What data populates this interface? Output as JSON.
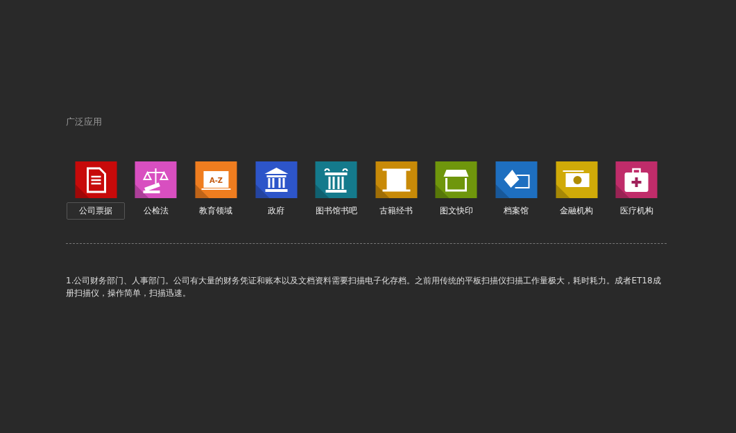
{
  "heading": "广泛应用",
  "items": [
    {
      "label": "公司票据",
      "selected": true,
      "kind": "document",
      "color": "#c70a0a"
    },
    {
      "label": "公检法",
      "selected": false,
      "kind": "scales",
      "color": "#d84fc0"
    },
    {
      "label": "教育领域",
      "selected": false,
      "kind": "board",
      "color": "#ef7d1f",
      "icon_text": "A-Z"
    },
    {
      "label": "政府",
      "selected": false,
      "kind": "building",
      "color": "#2d55c9"
    },
    {
      "label": "图书馆书吧",
      "selected": false,
      "kind": "column",
      "color": "#147a8c"
    },
    {
      "label": "古籍经书",
      "selected": false,
      "kind": "scroll",
      "color": "#c88a08"
    },
    {
      "label": "图文快印",
      "selected": false,
      "kind": "shop",
      "color": "#6f960c"
    },
    {
      "label": "档案馆",
      "selected": false,
      "kind": "folder",
      "color": "#1e6fc0"
    },
    {
      "label": "金融机构",
      "selected": false,
      "kind": "money",
      "color": "#d0aa08"
    },
    {
      "label": "医疗机构",
      "selected": false,
      "kind": "medkit",
      "color": "#c02c6a"
    }
  ],
  "description": "1.公司财务部门、人事部门。公司有大量的财务凭证和账本以及文档资料需要扫描电子化存档。之前用传统的平板扫描仪扫描工作量极大，耗时耗力。成者ET18成册扫描仪，操作简单，扫描迅速。"
}
